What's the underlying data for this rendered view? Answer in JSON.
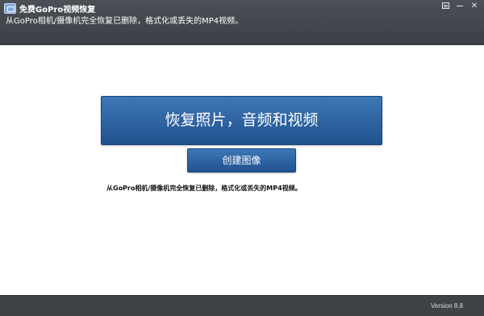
{
  "window": {
    "title": "免费GoPro视频恢复",
    "subtitle": "从GoPro相机/摄像机完全恢复已删除，格式化或丢失的MP4视频。",
    "controls": {
      "menu_icon": "menu-icon",
      "minimize_icon": "minimize-icon",
      "close_label": "✕"
    }
  },
  "main": {
    "recover_button_label": "恢复照片，音频和视频",
    "create_image_button_label": "创建图像",
    "description": "从GoPro相机/摄像机完全恢复已删除，格式化或丢失的MP4视频。"
  },
  "statusbar": {
    "version": "Version 8.8"
  },
  "colors": {
    "titlebar": "#43474d",
    "button": "#2c5f9d",
    "statusbar": "#3f4348"
  }
}
